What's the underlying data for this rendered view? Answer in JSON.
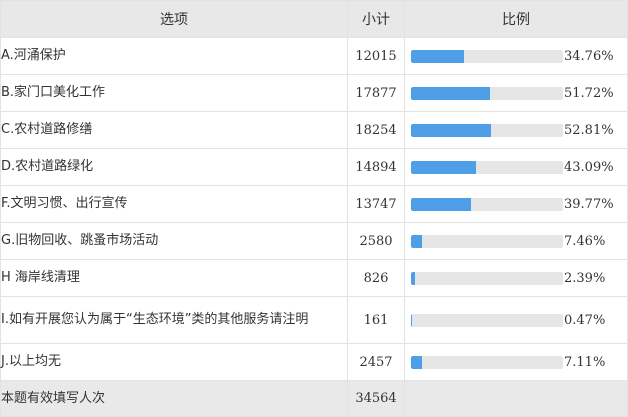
{
  "header": {
    "col_option": "选项",
    "col_count": "小计",
    "col_ratio": "比例"
  },
  "rows": [
    {
      "label": "A.河涌保护",
      "count": "12015",
      "percent": "34.76%",
      "value": 34.76
    },
    {
      "label": "B.家门口美化工作",
      "count": "17877",
      "percent": "51.72%",
      "value": 51.72
    },
    {
      "label": "C.农村道路修缮",
      "count": "18254",
      "percent": "52.81%",
      "value": 52.81
    },
    {
      "label": "D.农村道路绿化",
      "count": "14894",
      "percent": "43.09%",
      "value": 43.09
    },
    {
      "label": "F.文明习惯、出行宣传",
      "count": "13747",
      "percent": "39.77%",
      "value": 39.77
    },
    {
      "label": "G.旧物回收、跳蚤市场活动",
      "count": "2580",
      "percent": "7.46%",
      "value": 7.46
    },
    {
      "label": "H 海岸线清理",
      "count": "826",
      "percent": "2.39%",
      "value": 2.39
    },
    {
      "label": "I.如有开展您认为属于“生态环境”类的其他服务请注明",
      "count": "161",
      "percent": "0.47%",
      "value": 0.47
    },
    {
      "label": "J.以上均无",
      "count": "2457",
      "percent": "7.11%",
      "value": 7.11
    }
  ],
  "total": {
    "label": "本题有效填写人次",
    "count": "34564"
  },
  "colors": {
    "bar_fill": "#4f9ee8",
    "bar_track": "#e6e6e6",
    "header_bg": "#e8e8e8"
  }
}
